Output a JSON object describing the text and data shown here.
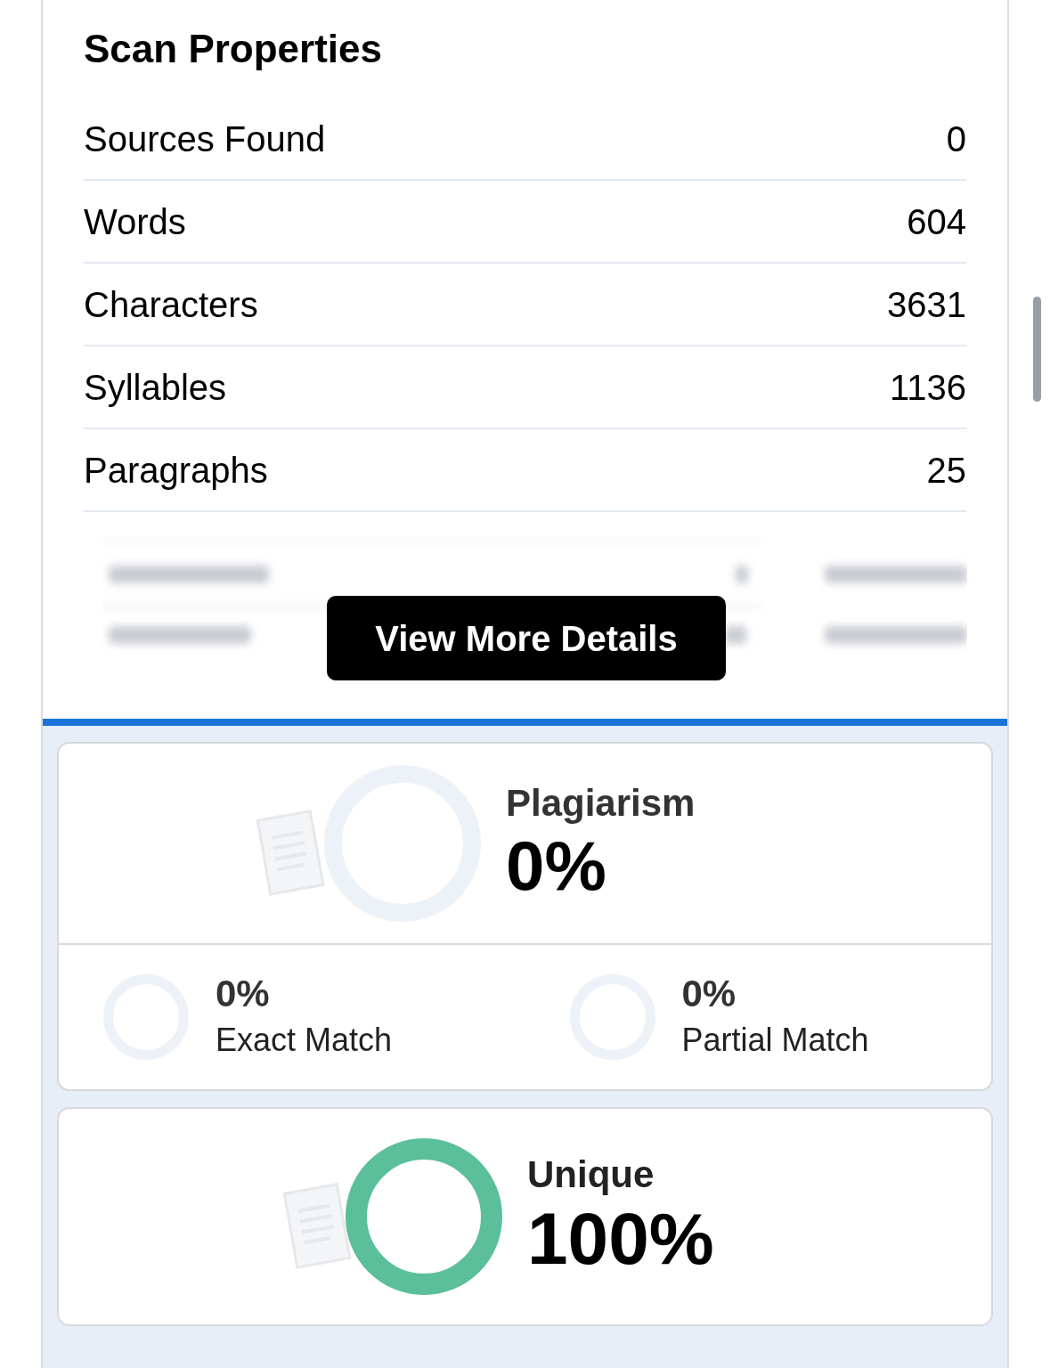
{
  "scan_properties": {
    "title": "Scan Properties",
    "rows": [
      {
        "label": "Sources Found",
        "value": "0"
      },
      {
        "label": "Words",
        "value": "604"
      },
      {
        "label": "Characters",
        "value": "3631"
      },
      {
        "label": "Syllables",
        "value": "1136"
      },
      {
        "label": "Paragraphs",
        "value": "25"
      }
    ],
    "button": "View More Details"
  },
  "plagiarism": {
    "label": "Plagiarism",
    "value": "0%",
    "breakdown": [
      {
        "value": "0%",
        "label": "Exact Match"
      },
      {
        "value": "0%",
        "label": "Partial Match"
      }
    ]
  },
  "unique": {
    "label": "Unique",
    "value": "100%"
  }
}
